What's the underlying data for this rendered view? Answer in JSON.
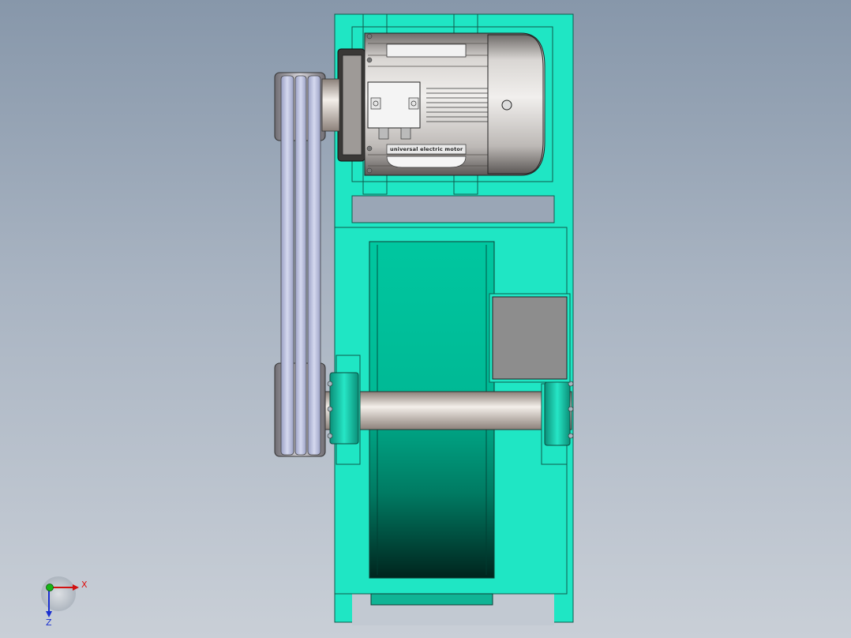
{
  "colors": {
    "background_top": "#8797aa",
    "background_bottom": "#c9cfd7",
    "frame": "#1fe6c4",
    "frame_edge": "#0f5a4c",
    "drum": "#00c29a",
    "drum_dark": "#002a22",
    "motor_metal": "#c7c3c0",
    "belt": "#b9bfdc",
    "gray_box": "#8d8d8d",
    "axis_x": "#d11111",
    "axis_y": "#16b416",
    "axis_z": "#1a2fd0"
  },
  "motor": {
    "nameplate_text": "universal electric motor"
  },
  "triad": {
    "x_label": "X",
    "z_label": "Z"
  }
}
